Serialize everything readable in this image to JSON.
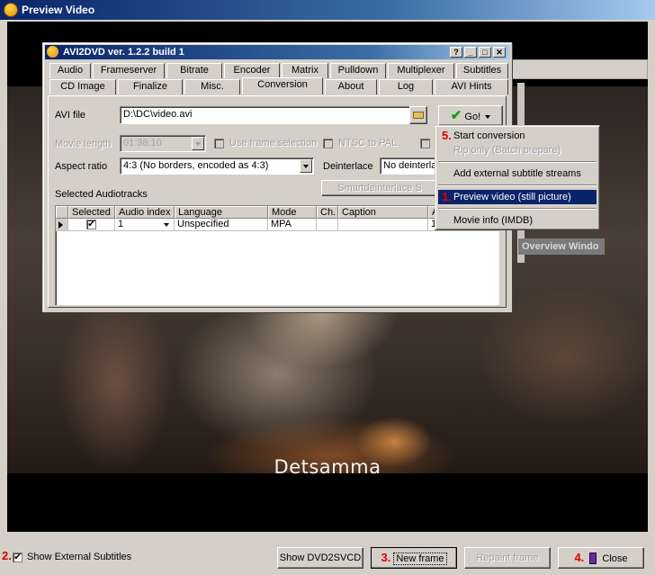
{
  "window": {
    "title": "Preview Video"
  },
  "video": {
    "subtitle": "Detsamma"
  },
  "overview_stub": {
    "label": "Overview Windo"
  },
  "bottom": {
    "tag2": "2.",
    "show_external_subtitles": "Show External Subtitles",
    "show_external_subtitles_checked": true,
    "show_dvd2svcd": "Show DVD2SVCD",
    "tag3": "3.",
    "new_frame": "New frame",
    "repaint_frame": "Repaint frame",
    "tag4": "4.",
    "close": "Close"
  },
  "avi2dvd": {
    "title": "AVI2DVD ver. 1.2.2 build 1",
    "tabs_row1": [
      "Audio",
      "Frameserver",
      "Bitrate",
      "Encoder",
      "Matrix",
      "Pulldown",
      "Multiplexer",
      "Subtitles"
    ],
    "tabs_row2": [
      "CD Image",
      "Finalize",
      "Misc.",
      "Conversion",
      "About",
      "Log",
      "AVI Hints"
    ],
    "active_tab": "Conversion",
    "avi_file_label": "AVI file",
    "avi_file_value": "D:\\DC\\video.avi",
    "go_label": "Go!",
    "movie_length_label": "Movie length",
    "movie_length_value": "01:38:10",
    "use_frame_selection": "Use frame selection",
    "ntsc_to_pal": "NTSC to PAL",
    "aspect_ratio_label": "Aspect ratio",
    "aspect_ratio_value": "4:3 (No borders, encoded as 4:3)",
    "deinterlace_label": "Deinterlace",
    "deinterlace_value": "No deinterlac",
    "smartdeinterlace": "Smartdeinterlace S",
    "audiotracks_label": "Selected Audiotracks",
    "grid_headers": [
      "Selected",
      "Audio index",
      "Language",
      "Mode",
      "Ch.",
      "Caption",
      "A"
    ],
    "grid_row": {
      "selected": true,
      "audio_index": "1",
      "language": "Unspecified",
      "mode": "MPA",
      "ch": "",
      "caption": "",
      "a": "1"
    }
  },
  "menu": {
    "tag5": "5.",
    "items": [
      {
        "label": "Start conversion",
        "state": "normal"
      },
      {
        "label": "Rip only (Batch prepare)",
        "state": "disabled"
      },
      {
        "label": "Add external subtitle streams",
        "state": "normal"
      },
      {
        "label": "Preview video (still picture)",
        "state": "selected",
        "tag": "1."
      },
      {
        "label": "Movie info (IMDB)",
        "state": "normal"
      }
    ]
  },
  "colors": {
    "accent_tag": "#e00000",
    "titlebar": "#0a246a",
    "selection": "#0a246a",
    "go_check": "#1a9a1a"
  }
}
